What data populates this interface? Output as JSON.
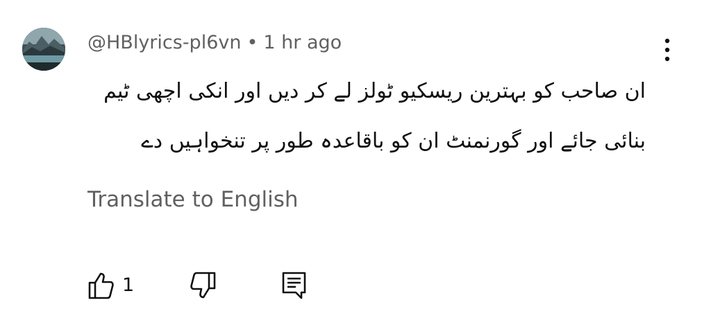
{
  "comment": {
    "author": "@HBlyrics-pl6vn",
    "separator": "•",
    "time": "1 hr ago",
    "text_line1": "ان صاحب کو بہترین ریسکیو ٹولز لے کر دیں اور انکی اچھی ٹیم",
    "text_line2": "بنائی جائے اور گورنمنٹ ان کو باقاعدہ طور پر تنخواہیں دے",
    "translate_label": "Translate to English",
    "like_count": "1"
  },
  "icons": {
    "menu": "more-vert-icon",
    "like": "thumbs-up-icon",
    "dislike": "thumbs-down-icon",
    "reply": "comment-reply-icon"
  },
  "colors": {
    "primary_text": "#0f0f0f",
    "secondary_text": "#606060"
  }
}
